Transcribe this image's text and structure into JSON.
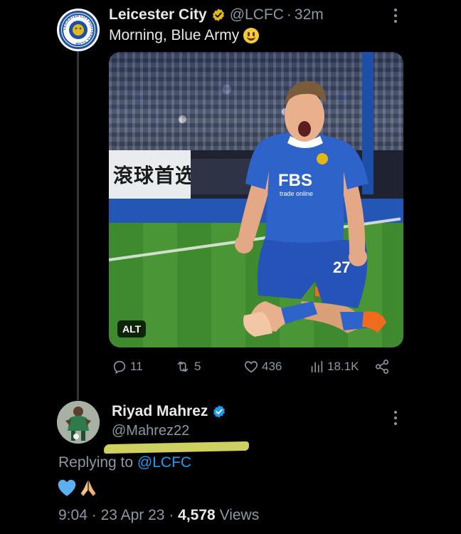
{
  "tweet": {
    "author_name": "Leicester City",
    "author_handle": "@LCFC",
    "separator": "·",
    "time_ago": "32m",
    "text": "Morning, Blue Army",
    "emoji": "grinning-face",
    "avatar_text": "LEICESTER CITY FOOTBALL CLUB",
    "media": {
      "alt_badge": "ALT",
      "board_text": "滾球首选",
      "sponsor": "FBS",
      "sponsor_sub": "trade online",
      "shirt_number": "27"
    },
    "actions": {
      "replies": "11",
      "retweets": "5",
      "likes": "436",
      "views": "18.1K"
    }
  },
  "reply": {
    "author_name": "Riyad Mahrez",
    "author_handle": "@Mahrez22",
    "replying_prefix": "Replying to",
    "replying_mention": "@LCFC",
    "content_emojis": [
      "blue-heart",
      "folded-hands"
    ],
    "time": "9:04",
    "separator": "·",
    "date": "23 Apr 23",
    "views_count": "4,578",
    "views_label": "Views"
  },
  "colors": {
    "background": "#000000",
    "text_primary": "#e7e9ea",
    "text_secondary": "#8b98a5",
    "link": "#1d9bf0",
    "verified_gold": "#e2b719",
    "verified_blue": "#1d9bf0",
    "highlight": "#e4e86a"
  }
}
